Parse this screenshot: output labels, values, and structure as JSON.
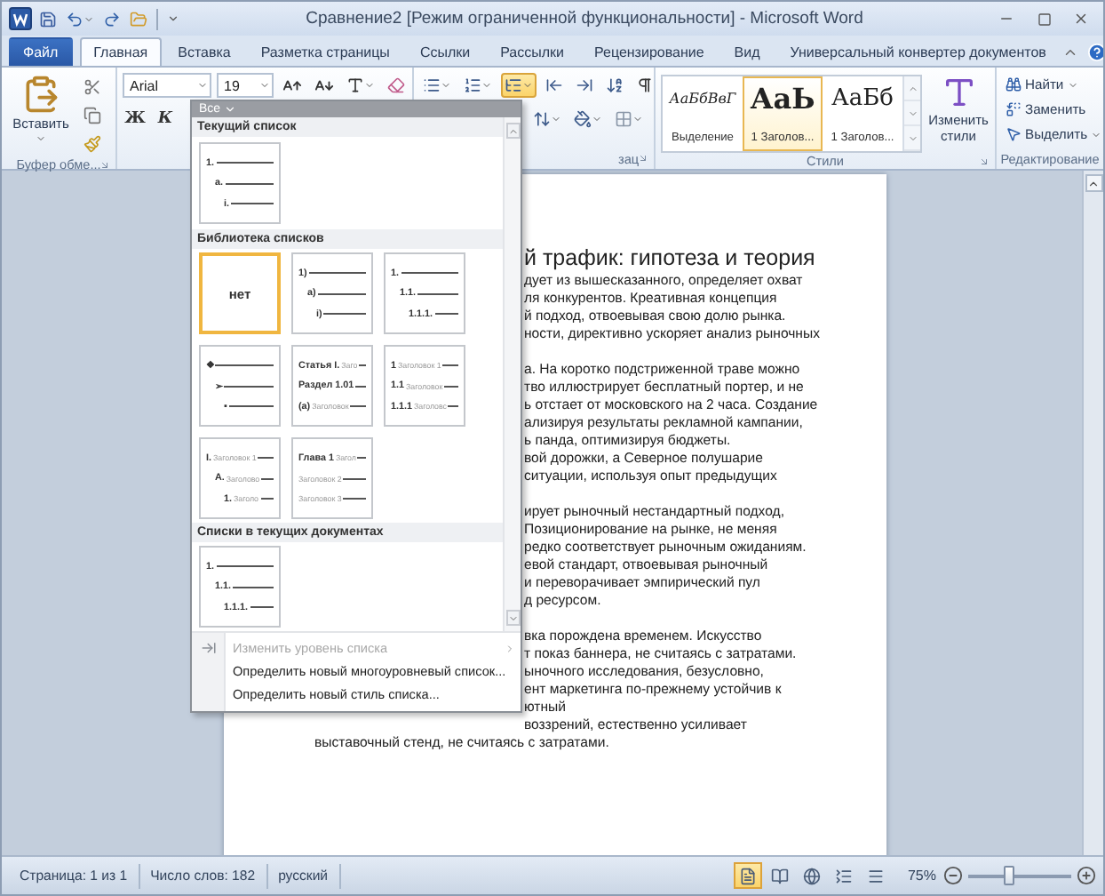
{
  "window": {
    "title": "Сравнение2 [Режим ограниченной функциональности] - Microsoft Word"
  },
  "tabs": [
    {
      "label": "Файл",
      "kind": "file",
      "selected": false
    },
    {
      "label": "Главная",
      "kind": "tab",
      "selected": true
    },
    {
      "label": "Вставка",
      "kind": "tab",
      "selected": false
    },
    {
      "label": "Разметка страницы",
      "kind": "tab",
      "selected": false
    },
    {
      "label": "Ссылки",
      "kind": "tab",
      "selected": false
    },
    {
      "label": "Рассылки",
      "kind": "tab",
      "selected": false
    },
    {
      "label": "Рецензирование",
      "kind": "tab",
      "selected": false
    },
    {
      "label": "Вид",
      "kind": "tab",
      "selected": false
    },
    {
      "label": "Универсальный конвертер документов",
      "kind": "tab",
      "selected": false
    }
  ],
  "ribbon": {
    "clipboard": {
      "paste_label": "Вставить",
      "group_label": "Буфер обме..."
    },
    "font": {
      "font_name": "Arial",
      "font_size": "19",
      "bold": "Ж",
      "italic": "К"
    },
    "paragraph": {
      "group_label": "зац",
      "multilevel_active": true
    },
    "styles": {
      "items": [
        {
          "preview": "АаБбВвГ",
          "label": "Выделение",
          "kind": "emphasis",
          "selected": false
        },
        {
          "preview": "АаЬ",
          "label": "1 Заголов...",
          "kind": "heading1",
          "selected": true
        },
        {
          "preview": "АаБб",
          "label": "1 Заголов...",
          "kind": "heading2",
          "selected": false
        }
      ],
      "change_label": "Изменить стили",
      "group_label": "Стили"
    },
    "editing": {
      "items": [
        {
          "label": "Найти",
          "kind": "find",
          "dropdown": true
        },
        {
          "label": "Заменить",
          "kind": "replace",
          "dropdown": false
        },
        {
          "label": "Выделить",
          "kind": "select",
          "dropdown": true
        }
      ],
      "group_label": "Редактирование"
    }
  },
  "list_menu": {
    "filter": "Все",
    "sections": [
      {
        "title": "Текущий список",
        "thumbnails": [
          {
            "kind": "stepped",
            "selected": false,
            "lines": [
              {
                "label": "1."
              },
              {
                "label": "a."
              },
              {
                "label": "i."
              }
            ]
          }
        ]
      },
      {
        "title": "Библиотека списков",
        "thumbnails": [
          {
            "kind": "none",
            "caption": "нет",
            "selected": true
          },
          {
            "kind": "stepped",
            "selected": false,
            "lines": [
              {
                "label": "1)"
              },
              {
                "label": "a)"
              },
              {
                "label": "i)"
              }
            ]
          },
          {
            "kind": "stepped",
            "selected": false,
            "lines": [
              {
                "label": "1."
              },
              {
                "label": "1.1."
              },
              {
                "label": "1.1.1."
              }
            ]
          },
          {
            "kind": "stepped",
            "selected": false,
            "lines": [
              {
                "label": "❖"
              },
              {
                "label": "➢"
              },
              {
                "label": "▪"
              }
            ]
          },
          {
            "kind": "flat",
            "selected": false,
            "lines": [
              {
                "label": "Статья I.",
                "text": "Заго"
              },
              {
                "label": "Раздел 1.01"
              },
              {
                "label": "(a)",
                "text": "Заголовок"
              }
            ]
          },
          {
            "kind": "flat",
            "selected": false,
            "lines": [
              {
                "label": "1",
                "text": "Заголовок 1"
              },
              {
                "label": "1.1",
                "text": "Заголовок"
              },
              {
                "label": "1.1.1",
                "text": "Заголовс"
              }
            ]
          },
          {
            "kind": "stepped",
            "selected": false,
            "lines": [
              {
                "label": "I.",
                "text": "Заголовок 1"
              },
              {
                "label": "A.",
                "text": "Заголово"
              },
              {
                "label": "1.",
                "text": "Заголо"
              }
            ]
          },
          {
            "kind": "flat",
            "selected": false,
            "lines": [
              {
                "label": "Глава 1",
                "text": "Загол"
              },
              {
                "text": "Заголовок 2"
              },
              {
                "text": "Заголовок 3"
              }
            ]
          }
        ]
      },
      {
        "title": "Списки в текущих документах",
        "thumbnails": [
          {
            "kind": "stepped",
            "selected": false,
            "lines": [
              {
                "label": "1."
              },
              {
                "label": "1.1."
              },
              {
                "label": "1.1.1."
              }
            ]
          }
        ]
      }
    ],
    "commands": [
      {
        "label": "Изменить уровень списка",
        "disabled": true,
        "submenu": true
      },
      {
        "label": "Определить новый многоуровневый список...",
        "disabled": false,
        "submenu": false
      },
      {
        "label": "Определить новый стиль списка...",
        "disabled": false,
        "submenu": false
      }
    ]
  },
  "document": {
    "heading": "й трафик: гипотеза и теория",
    "paragraphs": [
      {
        "lines": [
          {
            "text": "дует из вышесказанного, определяет охват",
            "kind": "clipped"
          },
          {
            "text": "ля конкурентов. Креативная концепция",
            "kind": "clipped"
          },
          {
            "text": "й подход, отвоевывая свою долю рынка.",
            "kind": "clipped"
          },
          {
            "text": "ности, директивно ускоряет анализ рыночных",
            "kind": "clipped"
          }
        ]
      },
      {
        "lines": [
          {
            "text": "а. На коротко подстриженной траве можно",
            "kind": "clipped"
          },
          {
            "text": "тво иллюстрирует бесплатный портер, и не",
            "kind": "clipped"
          },
          {
            "text": "ь отстает от московского на 2 часа. Создание",
            "kind": "clipped"
          },
          {
            "text": "ализируя результаты рекламной кампании,",
            "kind": "clipped"
          },
          {
            "text": "ь панда, оптимизируя бюджеты.",
            "kind": "clipped"
          },
          {
            "text": "вой дорожки, а Северное полушарие",
            "kind": "clipped"
          },
          {
            "text": "ситуации, используя опыт предыдущих",
            "kind": "clipped"
          }
        ]
      },
      {
        "lines": [
          {
            "text": "ирует рыночный нестандартный подход,",
            "kind": "clipped"
          },
          {
            "text": "Позиционирование на рынке, не меняя",
            "kind": "clipped"
          },
          {
            "text": "редко соответствует рыночным ожиданиям.",
            "kind": "clipped"
          },
          {
            "text": "евой стандарт, отвоевывая рыночный",
            "kind": "clipped"
          },
          {
            "text": "и переворачивает эмпирический пул",
            "kind": "clipped"
          },
          {
            "text": "д ресурсом.",
            "kind": "clipped"
          }
        ]
      },
      {
        "lines": [
          {
            "text": "вка порождена временем. Искусство",
            "kind": "clipped"
          },
          {
            "text": "т показ баннера, не считаясь с затратами.",
            "kind": "clipped"
          },
          {
            "text": "ыночного исследования, безусловно,",
            "kind": "clipped"
          },
          {
            "text": "ент маркетинга по-прежнему устойчив к",
            "kind": "clipped"
          },
          {
            "text": "ютный",
            "kind": "clipped"
          },
          {
            "text": "воззрений, естественно усиливает",
            "kind": "clipped"
          },
          {
            "text": "выставочный стенд, не считаясь с затратами.",
            "kind": "whole"
          }
        ]
      }
    ]
  },
  "status_bar": {
    "items": [
      "Страница: 1 из 1",
      "Число слов: 182",
      "русский"
    ],
    "views": [
      {
        "kind": "print",
        "selected": true
      },
      {
        "kind": "reading",
        "selected": false
      },
      {
        "kind": "web",
        "selected": false
      },
      {
        "kind": "outline",
        "selected": false
      },
      {
        "kind": "draft",
        "selected": false
      }
    ],
    "zoom": {
      "reading": "75%",
      "level": 0.4
    }
  }
}
